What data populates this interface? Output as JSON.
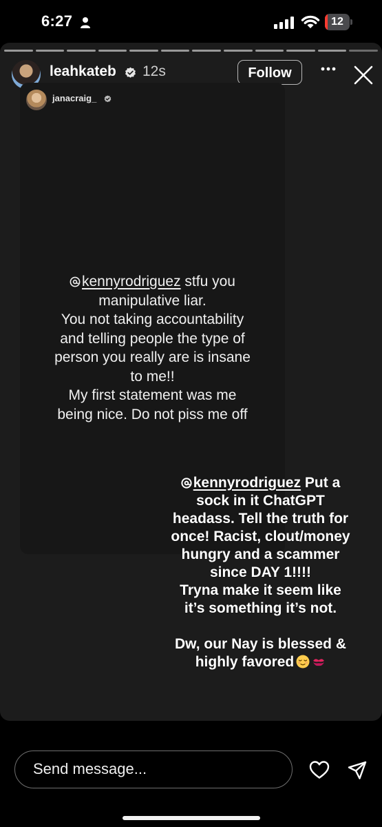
{
  "status_bar": {
    "time": "6:27",
    "battery_level": "12",
    "battery_fraction": 0.12,
    "battery_color": "#ff3b30"
  },
  "story": {
    "progress_segments": 12,
    "author": "leahkateb",
    "age": "12s",
    "follow_label": "Follow",
    "shared_post": {
      "username": "janacraig_",
      "mention": "kennyrodriguez",
      "line1_rest": " stfu you",
      "lines": [
        "manipulative liar.",
        "You not taking accountability",
        "and telling people the type of",
        "person you really are is insane",
        "to me!!",
        "My first statement was me",
        "being nice. Do not piss me off"
      ]
    },
    "overlay_text": {
      "mention": "kennyrodriguez",
      "line1_rest": " Put a",
      "lines": [
        "sock in it ChatGPT",
        "headass. Tell the truth for",
        "once! Racist, clout/money",
        "hungry and a scammer",
        "since DAY 1!!!!",
        "Tryna make it seem like",
        "it’s something it’s not."
      ],
      "closing_lines": [
        "Dw, our Nay is blessed &",
        "highly favored"
      ],
      "emojis": [
        "relieved-face-emoji",
        "kiss-mark-emoji"
      ]
    }
  },
  "footer": {
    "message_placeholder": "Send message...",
    "icons": [
      "heart-icon",
      "send-icon"
    ]
  }
}
